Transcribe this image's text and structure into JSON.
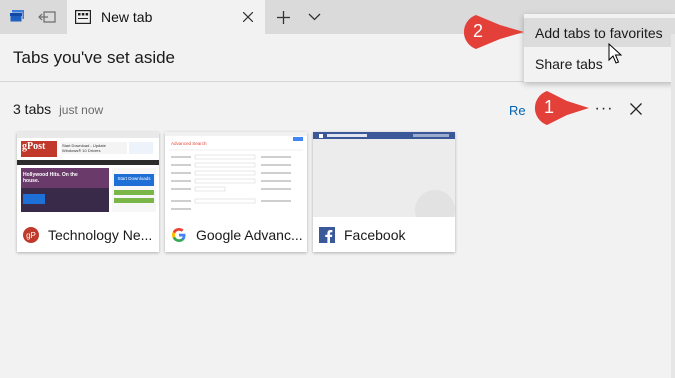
{
  "tabbar": {
    "active_tab": {
      "title": "New tab"
    }
  },
  "panel": {
    "title": "Tabs you've set aside",
    "group": {
      "count_label": "3 tabs",
      "time_label": "just now",
      "restore_label": "Re",
      "more_label": "···"
    },
    "cards": [
      {
        "title": "Technology Ne...",
        "favicon": "groovypost-icon",
        "thumb_labels": [
          "gPost",
          "Start Download - Update Windows® 10 Drivers",
          "Start Downloads",
          "Hollywood Hits. On the house."
        ]
      },
      {
        "title": "Google Advanc...",
        "favicon": "google-icon",
        "thumb_labels": [
          "Advanced Search"
        ]
      },
      {
        "title": "Facebook",
        "favicon": "facebook-icon",
        "thumb_labels": []
      }
    ]
  },
  "menu": {
    "items": [
      {
        "label": "Add tabs to favorites",
        "highlighted": true
      },
      {
        "label": "Share tabs",
        "highlighted": false
      }
    ]
  },
  "callouts": [
    {
      "number": "1"
    },
    {
      "number": "2"
    }
  ],
  "colors": {
    "callout_red": "#e3403a",
    "link_blue": "#0063b1",
    "facebook_blue": "#3b5998",
    "groovypost_red": "#c0392b"
  }
}
